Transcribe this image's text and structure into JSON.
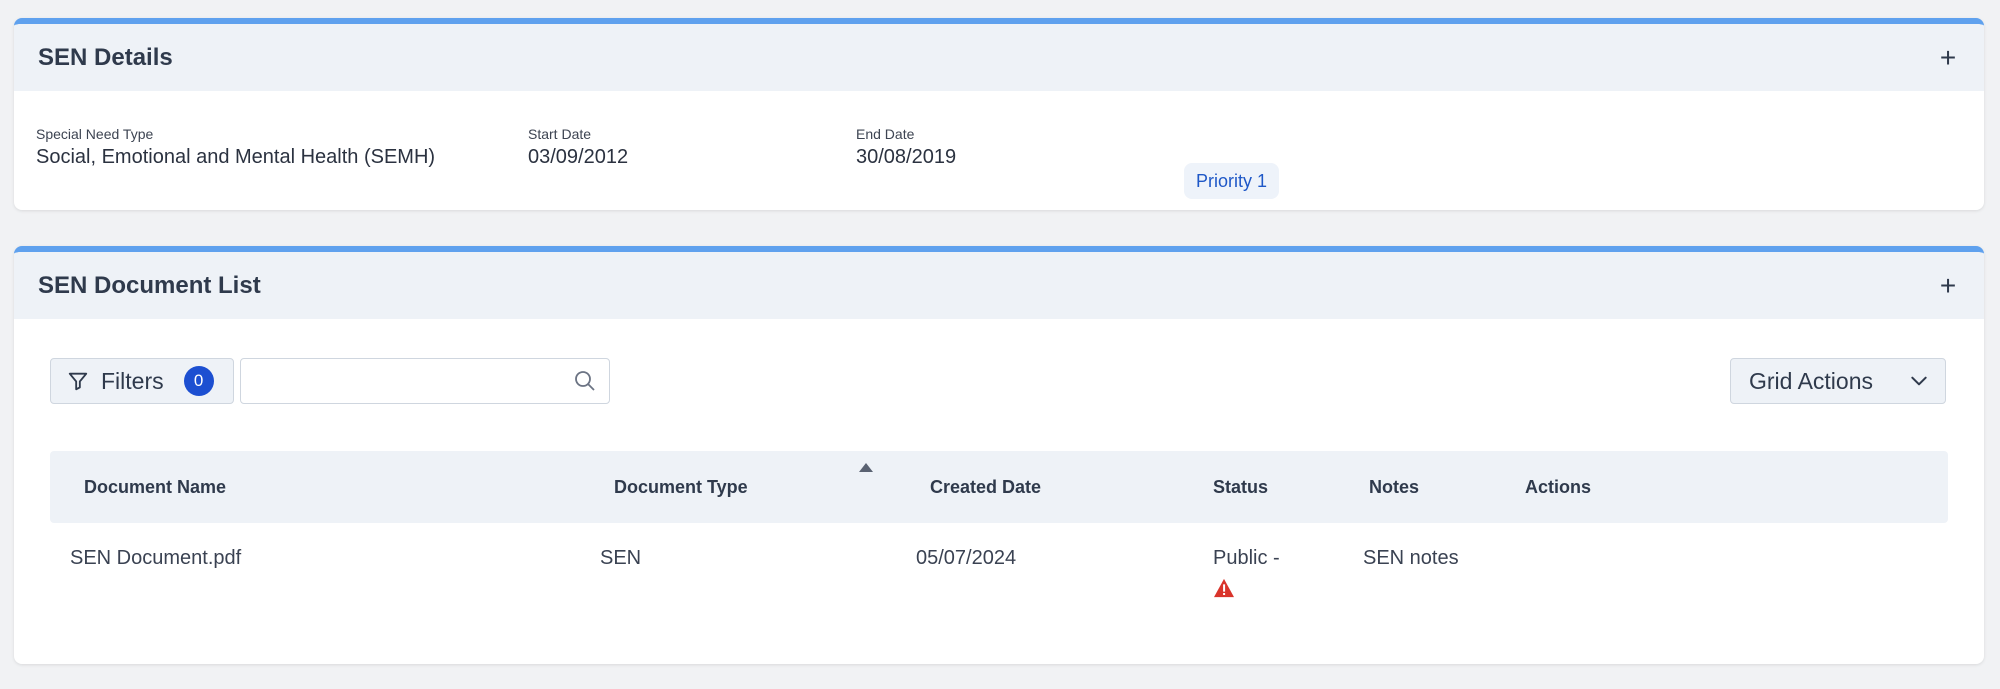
{
  "details": {
    "title": "SEN Details",
    "expand_icon": "+",
    "special_need_type_label": "Special Need Type",
    "special_need_type_value": "Social, Emotional and Mental Health (SEMH)",
    "start_date_label": "Start Date",
    "start_date_value": "03/09/2012",
    "end_date_label": "End Date",
    "end_date_value": "30/08/2019",
    "priority_badge": "Priority 1"
  },
  "document_list": {
    "title": "SEN Document List",
    "expand_icon": "+",
    "filters_label": "Filters",
    "filters_count": "0",
    "search_placeholder": "",
    "grid_actions_label": "Grid Actions",
    "columns": [
      "Document Name",
      "Document Type",
      "Created Date",
      "Status",
      "Notes",
      "Actions"
    ],
    "rows": [
      {
        "document_name": "SEN Document.pdf",
        "document_type": "SEN",
        "created_date": "05/07/2024",
        "status": "Public -",
        "status_icon": "warning-icon",
        "notes": "SEN notes",
        "actions": ""
      }
    ]
  },
  "colors": {
    "accent_border": "#5fa1ee",
    "badge_blue": "#1c4fd1",
    "warning_red": "#d9342b"
  }
}
